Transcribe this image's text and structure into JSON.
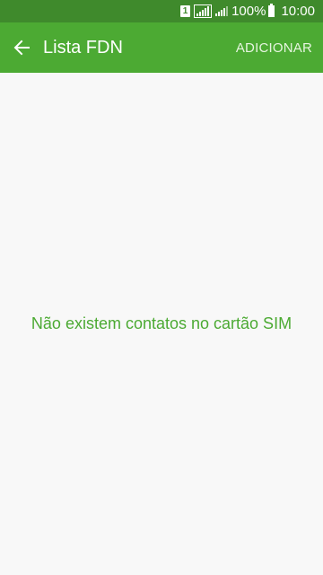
{
  "status_bar": {
    "sim_label": "1",
    "battery_percent": "100%",
    "time": "10:00"
  },
  "app_bar": {
    "back_icon": "arrow-left-icon",
    "title": "Lista FDN",
    "add_label": "ADICIONAR"
  },
  "content": {
    "empty_message": "Não existem contatos no cartão SIM"
  },
  "colors": {
    "status_bar": "#3f8a2c",
    "app_bar": "#4caa33",
    "background": "#f8f8f8",
    "accent_text": "#4caa33"
  }
}
